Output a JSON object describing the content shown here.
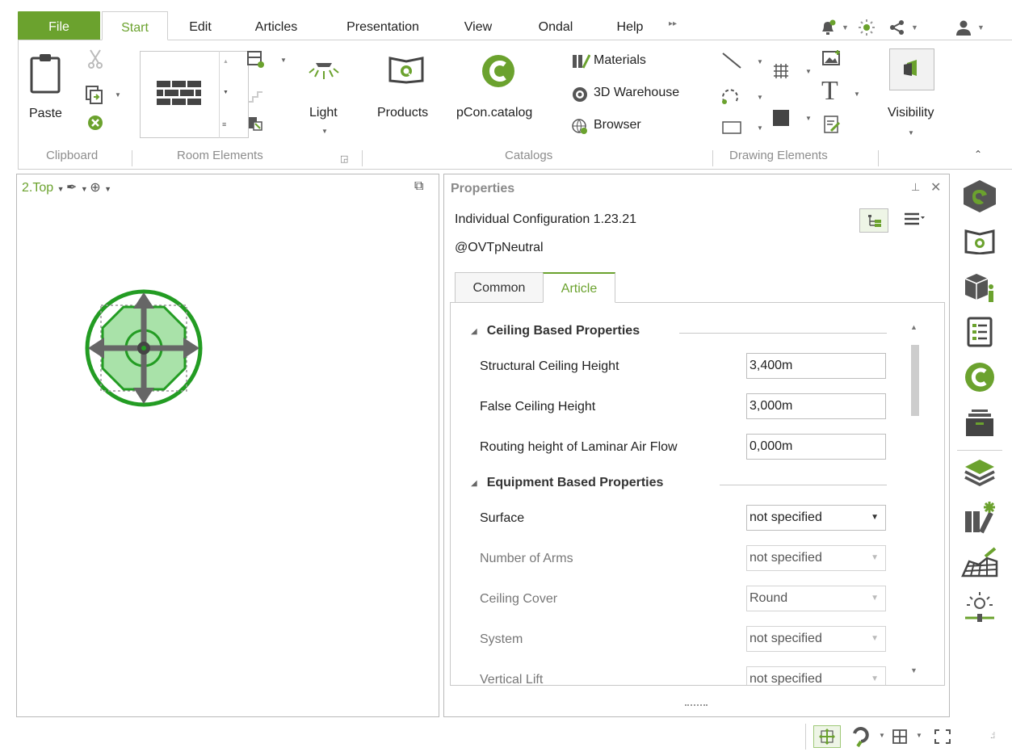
{
  "tabs": {
    "file": "File",
    "start": "Start",
    "edit": "Edit",
    "articles": "Articles",
    "presentation": "Presentation",
    "view": "View",
    "ondal": "Ondal",
    "help": "Help"
  },
  "ribbon": {
    "paste_label": "Paste",
    "light_label": "Light",
    "products_label": "Products",
    "pcon_label": "pCon.catalog",
    "materials_label": "Materials",
    "warehouse_label": "3D Warehouse",
    "browser_label": "Browser",
    "visibility_label": "Visibility",
    "groups": {
      "clipboard": "Clipboard",
      "room_elements": "Room Elements",
      "catalogs": "Catalogs",
      "drawing_elements": "Drawing Elements"
    }
  },
  "viewport": {
    "view_name": "2.Top"
  },
  "properties": {
    "title": "Properties",
    "configuration": "Individual Configuration 1.23.21",
    "owner": "@OVTpNeutral",
    "tabs": {
      "common": "Common",
      "article": "Article"
    },
    "sections": {
      "ceiling": "Ceiling Based Properties",
      "equipment": "Equipment Based Properties"
    },
    "rows": [
      {
        "label": "Structural Ceiling Height",
        "value": "3,400m"
      },
      {
        "label": "False Ceiling Height",
        "value": "3,000m"
      },
      {
        "label": "Routing height of Laminar Air Flow",
        "value": "0,000m"
      },
      {
        "label": "Surface",
        "value": "not specified"
      },
      {
        "label": "Number of Arms",
        "value": "not specified"
      },
      {
        "label": "Ceiling Cover",
        "value": "Round"
      },
      {
        "label": "System",
        "value": "not specified"
      },
      {
        "label": "Vertical Lift",
        "value": "not specified"
      }
    ]
  },
  "colors": {
    "accent": "#6ba22e",
    "icon_gray": "#555555",
    "disabled_text": "#777777"
  },
  "icons": [
    "bell-icon",
    "sun-icon",
    "share-icon",
    "user-icon",
    "paste-icon",
    "cut-icon",
    "copy-icon",
    "delete-icon",
    "wall-icon",
    "light-icon",
    "products-icon",
    "pcon-catalog-icon",
    "materials-icon",
    "warehouse-icon",
    "browser-icon",
    "line-icon",
    "hatch-icon",
    "arc-icon",
    "rectangle-icon",
    "fill-icon",
    "image-icon",
    "text-icon",
    "edit-icon",
    "visibility-icon",
    "pin-icon",
    "close-icon",
    "tree-icon",
    "menu-icon",
    "settings-icon",
    "catalog-icon",
    "info-icon",
    "list-icon",
    "layers-icon",
    "material-editor-icon",
    "terrain-icon",
    "light-slider-icon",
    "move-icon",
    "rotate-icon",
    "grid-icon",
    "fullscreen-icon",
    "resize-grip-icon"
  ]
}
